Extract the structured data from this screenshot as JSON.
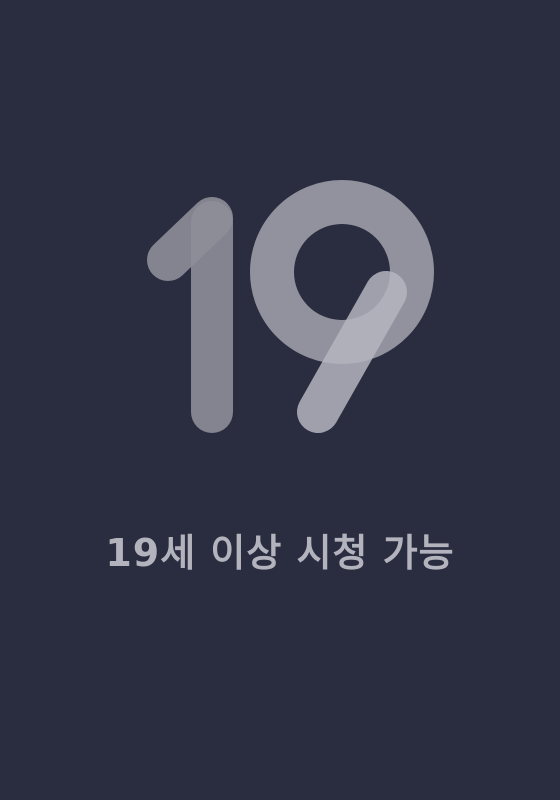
{
  "age_badge": {
    "number": "19",
    "icon": "age-19-restriction-icon"
  },
  "notice": {
    "text": "19세 이상 시청 가능"
  },
  "colors": {
    "background": "#2a2c3f",
    "badge_stroke": "#9a9aa6",
    "text": "#b3b3bd"
  }
}
